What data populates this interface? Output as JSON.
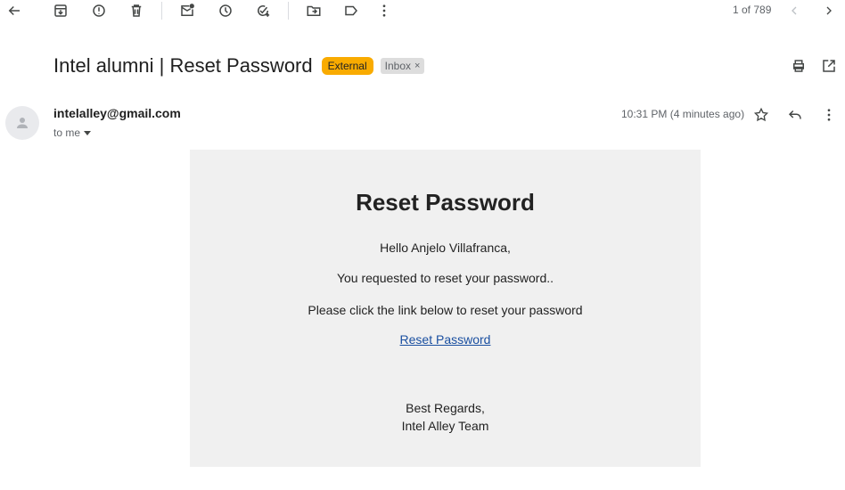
{
  "toolbar": {
    "icons": [
      "back-arrow-icon",
      "archive-icon",
      "report-spam-icon",
      "delete-icon",
      "mark-unread-icon",
      "snooze-icon",
      "add-to-tasks-icon",
      "move-to-icon",
      "label-icon",
      "more-vert-icon"
    ],
    "counter": "1 of 789"
  },
  "email": {
    "subject": "Intel alumni | Reset Password",
    "labels": {
      "external": "External",
      "inbox": "Inbox",
      "inbox_remove": "×"
    },
    "sender": "intelalley@gmail.com",
    "recipient": "to me",
    "timestamp": "10:31 PM (4 minutes ago)"
  },
  "body": {
    "title": "Reset Password",
    "greeting": "Hello Anjelo Villafranca,",
    "line1": "You requested to reset your password..",
    "line2": "Please click the link below to reset your password",
    "link": "Reset Password",
    "closing": "Best Regards,",
    "signature": "Intel Alley Team"
  },
  "colors": {
    "external_label": "#f9ab00",
    "inbox_label": "#dddddd",
    "body_bg": "#f0f0f0",
    "link": "#1a4fa0"
  }
}
